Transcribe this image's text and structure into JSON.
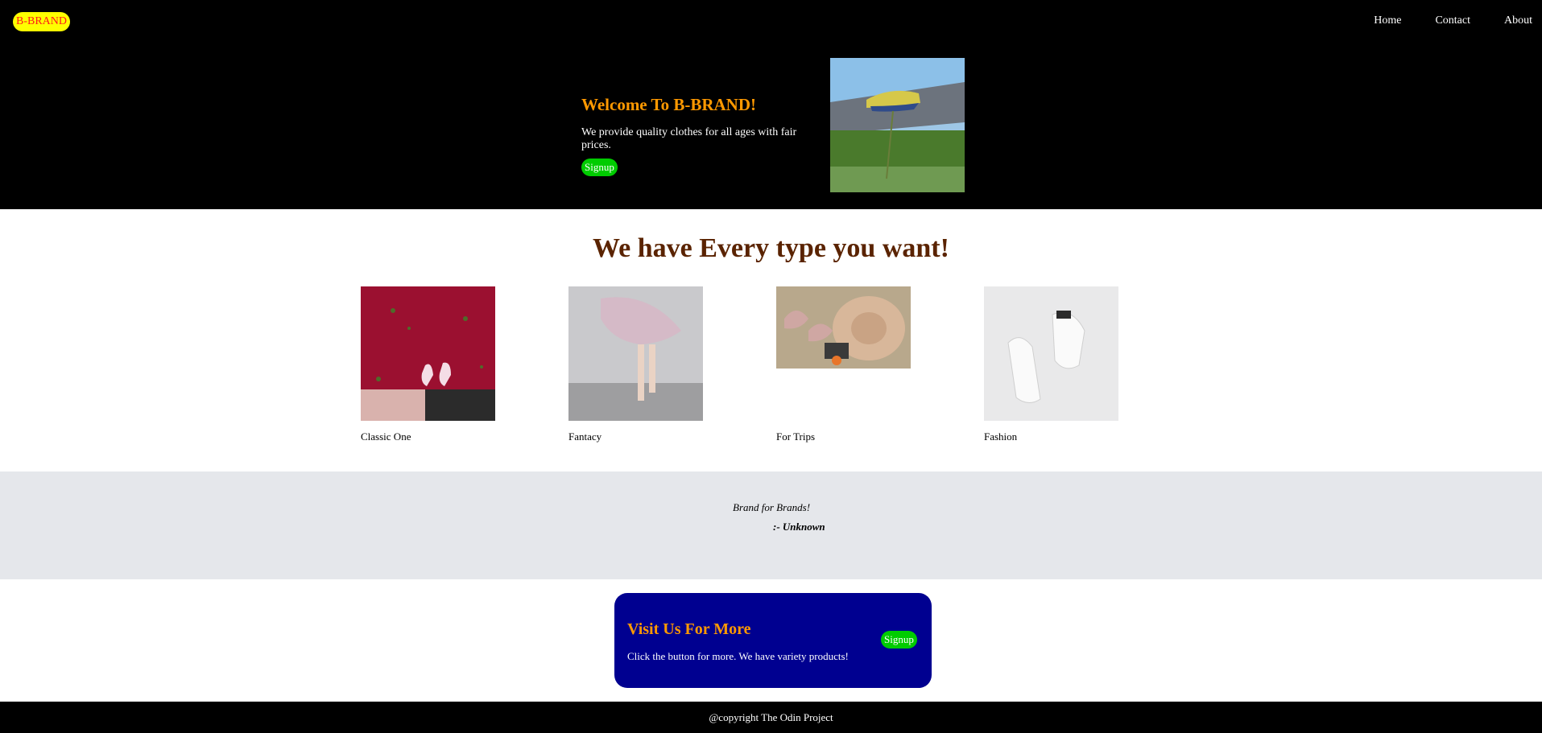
{
  "header": {
    "logo": "B-BRAND",
    "nav": [
      "Home",
      "Contact",
      "About"
    ]
  },
  "hero": {
    "title": "Welcome To B-BRAND!",
    "subtitle": "We provide quality clothes for all ages with fair prices.",
    "button": "Signup",
    "image_icon": "sneaker-image"
  },
  "catalog": {
    "title": "We have Every type you want!",
    "items": [
      {
        "label": "Classic One",
        "image_icon": "street-feet-image",
        "color": "#9b1030"
      },
      {
        "label": "Fantacy",
        "image_icon": "dancer-image",
        "color": "#d7b7c6"
      },
      {
        "label": "For Trips",
        "image_icon": "beach-hat-image",
        "color": "#b8a88c"
      },
      {
        "label": "Fashion",
        "image_icon": "white-sneakers-image",
        "color": "#e9e9ea"
      }
    ]
  },
  "quote": {
    "text": "Brand for Brands!",
    "author": ":- Unknown"
  },
  "cta": {
    "title": "Visit Us For More",
    "subtitle": "Click the button for more. We have variety products!",
    "button": "Signup"
  },
  "footer": {
    "text": "@copyright The Odin Project"
  },
  "colors": {
    "accent": "#ff9900",
    "signup": "#00cc00",
    "cta_bg": "#000090"
  }
}
